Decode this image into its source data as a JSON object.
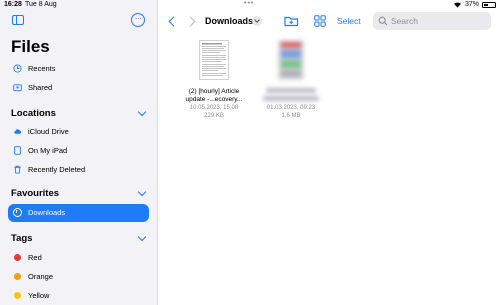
{
  "status_bar": {
    "time": "16:28",
    "date": "Tue 8 Aug",
    "battery": "37%"
  },
  "sidebar": {
    "title": "Files",
    "top_items": [
      {
        "label": "Recents",
        "icon": "clock-icon"
      },
      {
        "label": "Shared",
        "icon": "shared-folder-icon"
      }
    ],
    "sections": {
      "locations": {
        "header": "Locations",
        "items": [
          {
            "label": "iCloud Drive",
            "icon": "cloud-icon"
          },
          {
            "label": "On My iPad",
            "icon": "ipad-icon"
          },
          {
            "label": "Recently Deleted",
            "icon": "trash-icon"
          }
        ]
      },
      "favourites": {
        "header": "Favourites",
        "items": [
          {
            "label": "Downloads",
            "icon": "download-icon",
            "selected": true
          }
        ]
      },
      "tags": {
        "header": "Tags",
        "items": [
          {
            "label": "Red",
            "color": "#e5383b"
          },
          {
            "label": "Orange",
            "color": "#f59e0b"
          },
          {
            "label": "Yellow",
            "color": "#f5c518"
          }
        ]
      }
    }
  },
  "toolbar": {
    "folder_title": "Downloads",
    "select_label": "Select",
    "search_placeholder": "Search"
  },
  "files": [
    {
      "name_line1": "(2) [hourly] Article",
      "name_line2": "update -...ecovery...",
      "date": "10.05.2023, 15:08",
      "size": "229 KB"
    },
    {
      "name_line1": "",
      "name_line2": "",
      "date": "01.03.2023, 09:23",
      "size": "1,6 MB",
      "blurred": true
    }
  ],
  "colors": {
    "accent": "#1f7bf6",
    "sidebar_bg": "#f2f2f7"
  }
}
